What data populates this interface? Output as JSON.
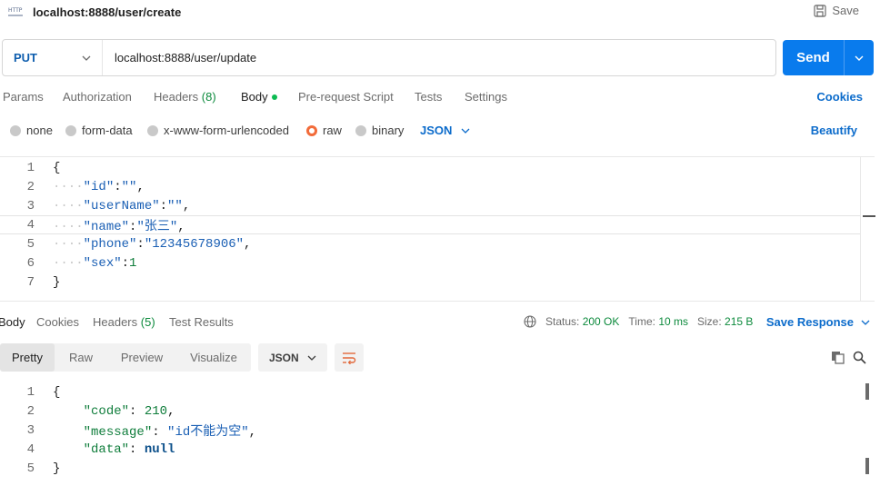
{
  "tab": {
    "title": "localhost:8888/user/create",
    "save_label": "Save"
  },
  "request": {
    "method": "PUT",
    "url": "localhost:8888/user/update",
    "send_label": "Send"
  },
  "req_tabs": {
    "params": "Params",
    "authorization": "Authorization",
    "headers": "Headers",
    "headers_count": "(8)",
    "body": "Body",
    "prescript": "Pre-request Script",
    "tests": "Tests",
    "settings": "Settings",
    "cookies": "Cookies"
  },
  "body_types": {
    "none": "none",
    "form_data": "form-data",
    "urlencoded": "x-www-form-urlencoded",
    "raw": "raw",
    "binary": "binary",
    "format": "JSON",
    "beautify": "Beautify"
  },
  "request_body": {
    "line_numbers": [
      "1",
      "2",
      "3",
      "4",
      "5",
      "6",
      "7"
    ],
    "open": "{",
    "close": "}",
    "k_id": "\"id\"",
    "v_id": "\"\"",
    "k_user": "\"userName\"",
    "v_user": "\"\"",
    "k_name": "\"name\"",
    "v_name": "\"张三\"",
    "k_phone": "\"phone\"",
    "v_phone": "\"12345678906\"",
    "k_sex": "\"sex\"",
    "v_sex": "1",
    "colon": ":",
    "comma": ",",
    "indent_dots": "····"
  },
  "resp_tabs": {
    "body": "Body",
    "cookies": "Cookies",
    "headers": "Headers",
    "headers_count": "(5)",
    "test_results": "Test Results"
  },
  "resp_meta": {
    "status_label": "Status:",
    "status_value": "200 OK",
    "time_label": "Time:",
    "time_value": "10 ms",
    "size_label": "Size:",
    "size_value": "215 B",
    "save_response": "Save Response"
  },
  "resp_view": {
    "pretty": "Pretty",
    "raw": "Raw",
    "preview": "Preview",
    "visualize": "Visualize",
    "format": "JSON"
  },
  "response_body": {
    "line_numbers": [
      "1",
      "2",
      "3",
      "4",
      "5"
    ],
    "open": "{",
    "close": "}",
    "k_code": "\"code\"",
    "v_code": "210",
    "k_message": "\"message\"",
    "v_message": "\"id不能为空\"",
    "k_data": "\"data\"",
    "v_data": "null"
  },
  "colors": {
    "accent": "#097bed",
    "success": "#0c8a3c",
    "radio_active": "#f26b3a"
  }
}
